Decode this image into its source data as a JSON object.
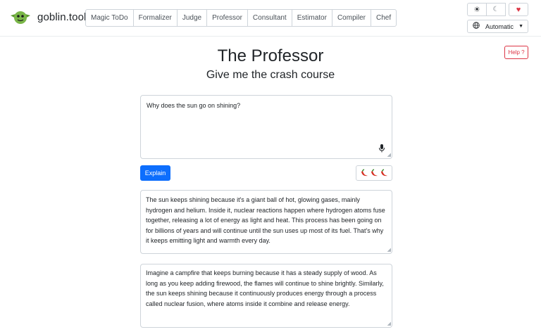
{
  "header": {
    "logo_text": "goblin.tools",
    "logo_icon": "goblin-face-icon",
    "nav_tabs": [
      "Magic ToDo",
      "Formalizer",
      "Judge",
      "Professor",
      "Consultant",
      "Estimator",
      "Compiler",
      "Chef"
    ],
    "theme_icons": [
      "sun-icon",
      "moon-icon",
      "heart-icon"
    ],
    "language": {
      "icon": "globe-icon",
      "selected": "Automatic"
    }
  },
  "help_label": "Help ?",
  "page": {
    "title": "The Professor",
    "subtitle": "Give me the crash course"
  },
  "question": {
    "value": "Why does the sun go on shining?",
    "mic_icon": "microphone-icon"
  },
  "explain_button": "Explain",
  "spiciness": {
    "icon": "chili-pepper-icon",
    "level": 3,
    "max": 3
  },
  "answers": [
    "The sun keeps shining because it's a giant ball of hot, glowing gases, mainly hydrogen and helium. Inside it, nuclear reactions happen where hydrogen atoms fuse together, releasing a lot of energy as light and heat. This process has been going on for billions of years and will continue until the sun uses up most of its fuel. That's why it keeps emitting light and warmth every day.",
    "Imagine a campfire that keeps burning because it has a steady supply of wood. As long as you keep adding firewood, the flames will continue to shine brightly. Similarly, the sun keeps shining because it continuously produces energy through a process called nuclear fusion, where atoms inside it combine and release energy."
  ],
  "colors": {
    "primary": "#0d6efd",
    "danger": "#dc3545",
    "goblin_green": "#7ab648",
    "border": "#ced4da"
  }
}
